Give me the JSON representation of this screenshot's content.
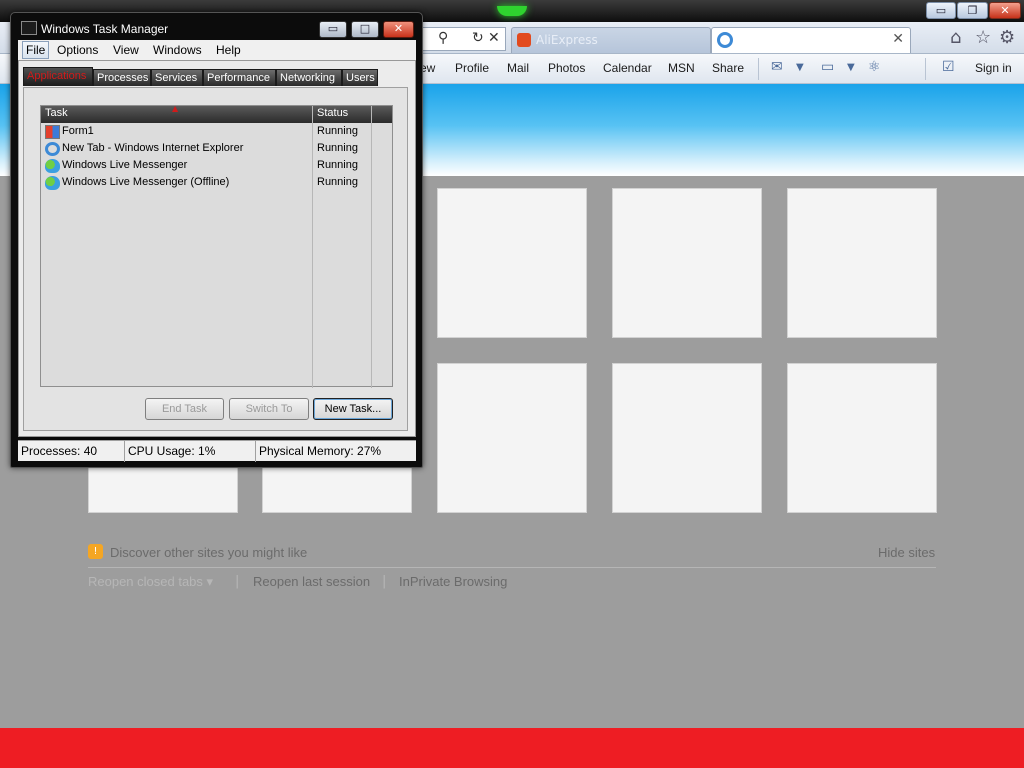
{
  "ie": {
    "tabs": [
      {
        "label": "AliExpress",
        "active": false
      },
      {
        "label": "",
        "active": true
      }
    ],
    "command_bar": {
      "items": [
        "ew",
        "Profile",
        "Mail",
        "Photos",
        "Calendar",
        "MSN",
        "Share"
      ],
      "sign_in": "Sign in"
    },
    "new_tab_page": {
      "discover_text": "Discover other sites you might like",
      "hide_sites": "Hide sites",
      "reopen_closed_tabs": "Reopen closed tabs ▾",
      "separator": "|",
      "reopen_last_session": "Reopen last session",
      "inprivate": "InPrivate Browsing"
    },
    "colors": {
      "band_top": "#1aa3ea",
      "footer_red": "#ee1d23"
    }
  },
  "task_manager": {
    "title": "Windows Task Manager",
    "window_buttons": {
      "minimize": "▭",
      "maximize": "□",
      "close": "✕"
    },
    "menu": [
      "File",
      "Options",
      "View",
      "Windows",
      "Help"
    ],
    "tabs": [
      "Applications",
      "Processes",
      "Services",
      "Performance",
      "Networking",
      "Users"
    ],
    "active_tab": "Applications",
    "columns": {
      "task": "Task",
      "status": "Status"
    },
    "rows": [
      {
        "task": "Form1",
        "status": "Running",
        "icon": "form-icon"
      },
      {
        "task": "New Tab - Windows Internet Explorer",
        "status": "Running",
        "icon": "ie-icon"
      },
      {
        "task": "Windows Live Messenger",
        "status": "Running",
        "icon": "messenger-icon"
      },
      {
        "task": "Windows Live Messenger (Offline)",
        "status": "Running",
        "icon": "messenger-icon"
      }
    ],
    "buttons": {
      "end_task": "End Task",
      "switch_to": "Switch To",
      "new_task": "New Task..."
    },
    "status_bar": {
      "processes": "Processes: 40",
      "cpu": "CPU Usage: 1%",
      "memory": "Physical Memory: 27%"
    }
  }
}
